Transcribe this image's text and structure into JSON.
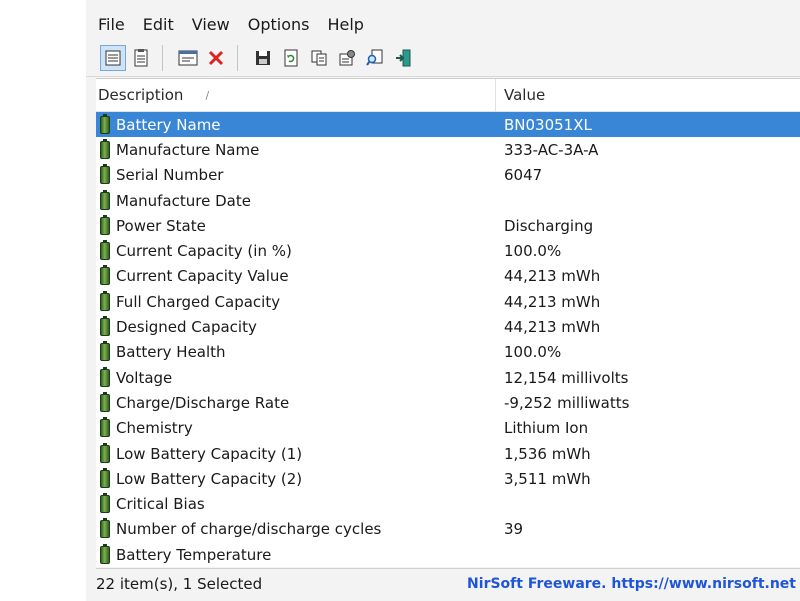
{
  "menu": [
    "File",
    "Edit",
    "View",
    "Options",
    "Help"
  ],
  "toolbar_icons": [
    "view-details-icon",
    "view-list-icon",
    "properties-window-icon",
    "delete-icon",
    "save-icon",
    "refresh-icon",
    "copy-icon",
    "html-report-icon",
    "find-icon",
    "exit-icon"
  ],
  "list": {
    "columns": {
      "description": "Description",
      "value": "Value"
    },
    "selected_index": 0,
    "rows": [
      {
        "description": "Battery Name",
        "value": "BN03051XL"
      },
      {
        "description": "Manufacture Name",
        "value": "333-AC-3A-A"
      },
      {
        "description": "Serial Number",
        "value": "6047"
      },
      {
        "description": "Manufacture Date",
        "value": ""
      },
      {
        "description": "Power State",
        "value": "Discharging"
      },
      {
        "description": "Current Capacity (in %)",
        "value": "100.0%"
      },
      {
        "description": "Current Capacity Value",
        "value": "44,213 mWh"
      },
      {
        "description": "Full Charged Capacity",
        "value": "44,213 mWh"
      },
      {
        "description": "Designed Capacity",
        "value": "44,213 mWh"
      },
      {
        "description": "Battery Health",
        "value": "100.0%"
      },
      {
        "description": "Voltage",
        "value": "12,154 millivolts"
      },
      {
        "description": "Charge/Discharge Rate",
        "value": "-9,252 milliwatts"
      },
      {
        "description": "Chemistry",
        "value": "Lithium Ion"
      },
      {
        "description": "Low Battery Capacity (1)",
        "value": "1,536 mWh"
      },
      {
        "description": "Low Battery Capacity (2)",
        "value": "3,511 mWh"
      },
      {
        "description": "Critical Bias",
        "value": ""
      },
      {
        "description": "Number of charge/discharge cycles",
        "value": "39"
      },
      {
        "description": "Battery Temperature",
        "value": ""
      }
    ]
  },
  "status": {
    "items": "22 item(s), 1 Selected",
    "link": "NirSoft Freeware. https://www.nirsoft.net"
  },
  "colors": {
    "selection": "#3a86d6",
    "link": "#1f56d8",
    "battery_icon": "#4f8a32"
  }
}
